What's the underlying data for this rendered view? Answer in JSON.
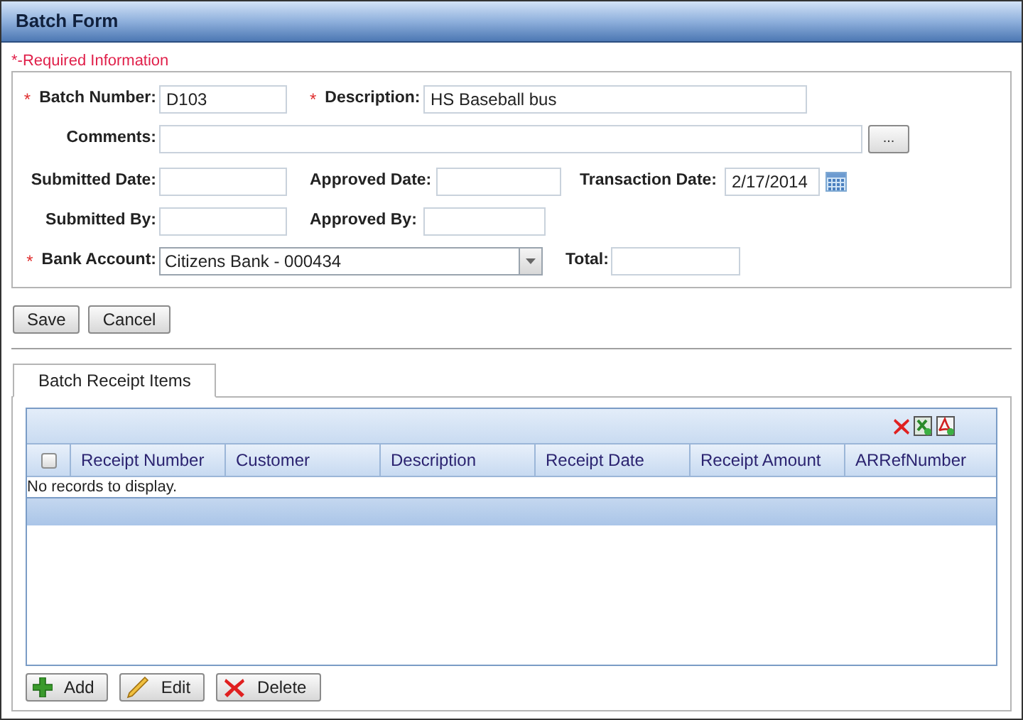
{
  "window": {
    "title": "Batch Form"
  },
  "required_note": "*-Required Information",
  "required_mark": "*",
  "form_rows": [
    [
      {
        "kind": "text",
        "label": "Batch Number:",
        "required": true,
        "value": "D103"
      },
      {
        "kind": "text",
        "label": "Description:",
        "required": true,
        "value": "HS Baseball bus"
      }
    ],
    [
      {
        "kind": "browse",
        "label": "Comments:",
        "required": false,
        "button": "..."
      }
    ],
    [
      {
        "kind": "text",
        "label": "Submitted Date:",
        "required": false
      },
      {
        "kind": "text",
        "label": "Approved Date:",
        "required": false
      },
      {
        "kind": "date",
        "label": "Transaction Date:",
        "required": false,
        "value": "2/17/2014"
      }
    ],
    [
      {
        "kind": "text",
        "label": "Submitted By:",
        "required": false
      },
      {
        "kind": "text",
        "label": "Approved By:",
        "required": false
      }
    ],
    [
      {
        "kind": "select",
        "label": "Bank Account:",
        "required": true,
        "value": "Citizens Bank - 000434"
      },
      {
        "kind": "text",
        "label": "Total:",
        "required": false
      }
    ]
  ],
  "actions": [
    "Save",
    "Cancel"
  ],
  "tabs": [
    {
      "label": "Batch Receipt Items",
      "selected": true
    }
  ],
  "grid": {
    "header_checkbox": {
      "checked": false
    },
    "columns": [
      "Receipt Number",
      "Customer",
      "Description",
      "Receipt Date",
      "Receipt Amount",
      "ARRefNumber"
    ],
    "empty_message": "No records to display."
  },
  "grid_buttons": [
    {
      "kind": "add",
      "label": "Add"
    },
    {
      "kind": "edit",
      "label": "Edit"
    },
    {
      "kind": "delete",
      "label": "Delete"
    }
  ]
}
